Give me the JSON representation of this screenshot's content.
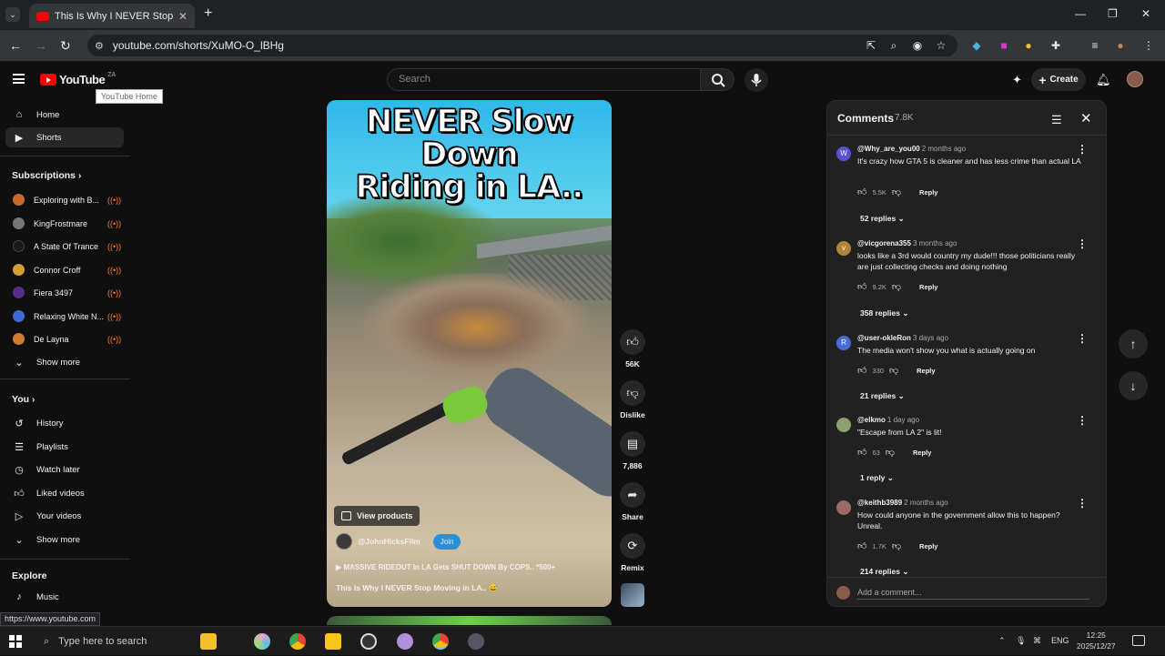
{
  "browser": {
    "tab_title": "This Is Why I NEVER Stop M",
    "url": "youtube.com/shorts/XuMO-O_lBHg",
    "status_url": "https://www.youtube.com"
  },
  "header": {
    "logo_text": "YouTube",
    "logo_country": "ZA",
    "tooltip": "YouTube Home",
    "search_placeholder": "Search",
    "create_label": "Create"
  },
  "sidebar": {
    "main": [
      {
        "label": "Home",
        "icon": "home-icon"
      },
      {
        "label": "Shorts",
        "icon": "shorts-icon"
      }
    ],
    "subscriptions_title": "Subscriptions",
    "subscriptions": [
      {
        "label": "Exploring with B...",
        "color": "#c96a2c"
      },
      {
        "label": "KingFrostmare",
        "color": "#777777"
      },
      {
        "label": "A State Of Trance",
        "color": "#1a1a1a"
      },
      {
        "label": "Connor Croff",
        "color": "#d1a030"
      },
      {
        "label": "Fiera 3497",
        "color": "#5a2a8a"
      },
      {
        "label": "Relaxing White N...",
        "color": "#3d6bd8"
      },
      {
        "label": "De Layna",
        "color": "#d07a30"
      }
    ],
    "show_more": "Show more",
    "you_title": "You",
    "you_items": [
      {
        "label": "History",
        "icon": "history-icon"
      },
      {
        "label": "Playlists",
        "icon": "playlists-icon"
      },
      {
        "label": "Watch later",
        "icon": "clock-icon"
      },
      {
        "label": "Liked videos",
        "icon": "thumb-up-icon"
      },
      {
        "label": "Your videos",
        "icon": "play-square-icon"
      }
    ],
    "show_more_2": "Show more",
    "explore_title": "Explore",
    "explore_items": [
      {
        "label": "Music",
        "icon": "music-note-icon"
      }
    ]
  },
  "short": {
    "caption_line1": "NEVER Slow Down",
    "caption_line2": "Riding in LA..",
    "view_products": "View products",
    "channel": "@JohnHicksFilm",
    "join": "Join",
    "linked_video": "MASSIVE RIDEOUT In LA Gets SHUT DOWN By COPS.. *500+",
    "description": "This Is Why I NEVER Stop Moving in LA.. 😅"
  },
  "actions": {
    "likes": "56K",
    "dislike": "Dislike",
    "comments": "7,886",
    "share": "Share",
    "remix": "Remix"
  },
  "comments": {
    "title": "Comments",
    "count": "7.8K",
    "add_placeholder": "Add a comment...",
    "reply_label": "Reply",
    "items": [
      {
        "user": "@Why_are_you00",
        "time": "2 months ago",
        "text": "It's crazy how GTA 5 is cleaner and has less crime than actual LA",
        "likes": "5.5K",
        "replies": "52 replies",
        "avatar": "W",
        "color": "#5b4fd6"
      },
      {
        "user": "@vicgorena355",
        "time": "3 months ago",
        "text": "looks like a 3rd would country my dude!!! those politicians really are just collecting checks and doing nothing",
        "likes": "9.2K",
        "replies": "358 replies",
        "avatar": "v",
        "color": "#b0843a"
      },
      {
        "user": "@user-okleRon",
        "time": "3 days ago",
        "text": "The media won't show you what is actually going on",
        "likes": "330",
        "replies": "21 replies",
        "avatar": "R",
        "color": "#4a6ad8"
      },
      {
        "user": "@elkmo",
        "time": "1 day ago",
        "text": "\"Escape from LA 2\" is lit!",
        "likes": "63",
        "replies": "1 reply",
        "avatar": "",
        "color": "#8aa070"
      },
      {
        "user": "@keithb3989",
        "time": "2 months ago",
        "text": "How could anyone in the government allow this to happen? Unreal.",
        "likes": "1.7K",
        "replies": "214 replies",
        "avatar": "",
        "color": "#9a6a6a"
      }
    ]
  },
  "taskbar": {
    "search_placeholder": "Type here to search",
    "lang": "ENG",
    "time": "12:25",
    "date": "2025/12/27"
  }
}
